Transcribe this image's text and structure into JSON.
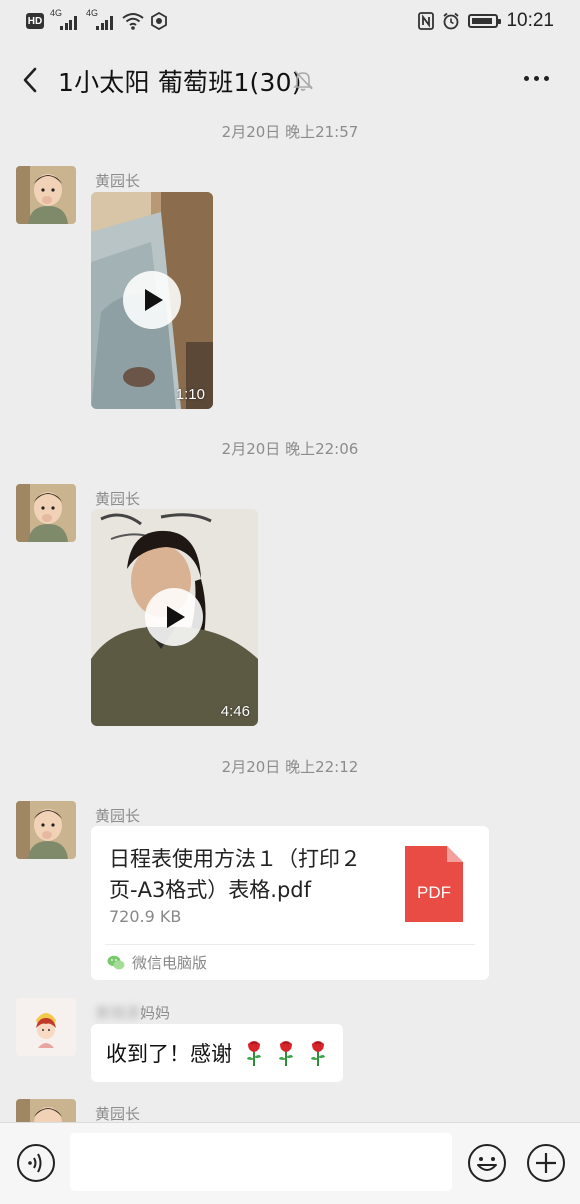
{
  "status_bar": {
    "hd": "HD",
    "signal1": "4G",
    "signal2": "4G",
    "time": "10:21"
  },
  "header": {
    "title": "1小太阳 葡萄班1(30)"
  },
  "messages": [
    {
      "type": "timestamp",
      "text": "2月20日 晚上21:57"
    },
    {
      "type": "video",
      "sender": "黄园长",
      "duration": "1:10"
    },
    {
      "type": "timestamp",
      "text": "2月20日 晚上22:06"
    },
    {
      "type": "video",
      "sender": "黄园长",
      "duration": "4:46"
    },
    {
      "type": "timestamp",
      "text": "2月20日 晚上22:12"
    },
    {
      "type": "file",
      "sender": "黄园长",
      "file_name": "日程表使用方法１（打印２页-A3格式）表格.pdf",
      "file_size": "720.9 KB",
      "file_type": "PDF",
      "source": "微信电脑版"
    },
    {
      "type": "text",
      "sender_blurred": "黄锦源",
      "sender_suffix": "妈妈",
      "text": "收到了！感谢"
    },
    {
      "type": "partial",
      "sender": "黄园长"
    }
  ],
  "input": {
    "placeholder": ""
  },
  "colors": {
    "background": "#ededed",
    "bubble": "#ffffff",
    "pdf_red": "#e94b45",
    "meta_gray": "#8c8c8c"
  },
  "icons": [
    "back-arrow-icon",
    "mute-bell-icon",
    "more-icon",
    "play-icon",
    "pdf-file-icon",
    "wechat-logo-icon",
    "rose-icon",
    "voice-icon",
    "emoji-icon",
    "plus-icon",
    "wifi-icon",
    "nfc-icon",
    "alarm-icon",
    "battery-icon"
  ]
}
